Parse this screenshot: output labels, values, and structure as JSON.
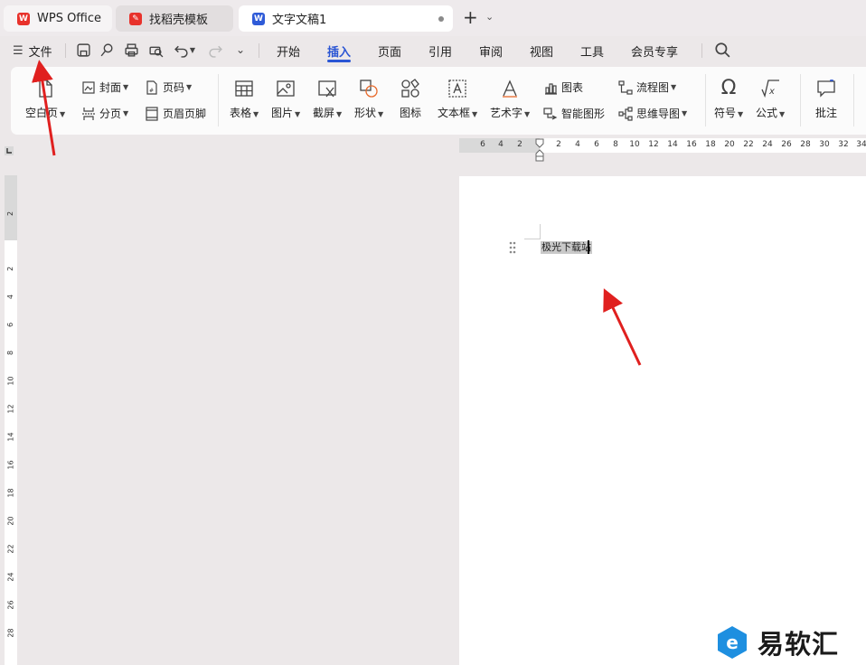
{
  "tabs": [
    {
      "label": "WPS Office",
      "color": "#e8322b",
      "icon": "wps-logo-icon"
    },
    {
      "label": "找稻壳模板",
      "color": "#e8322b",
      "icon": "docer-icon"
    },
    {
      "label": "文字文稿1",
      "color": "#2f5bd8",
      "icon": "word-doc-icon",
      "glyph": "W"
    }
  ],
  "new_tab": "+",
  "menu": {
    "file_label": "文件",
    "tabs": [
      "开始",
      "插入",
      "页面",
      "引用",
      "审阅",
      "视图",
      "工具",
      "会员专享"
    ],
    "active_tab": "插入",
    "accent": "#2a55d4"
  },
  "ribbon": {
    "blank_page": "空白页",
    "cover": "封面",
    "page_break": "分页",
    "page_number": "页码",
    "header_footer": "页眉页脚",
    "table": "表格",
    "picture": "图片",
    "screenshot": "截屏",
    "shape": "形状",
    "icon": "图标",
    "text_box": "文本框",
    "word_art": "艺术字",
    "chart": "图表",
    "smart_art": "智能图形",
    "flowchart": "流程图",
    "mind_map": "思维导图",
    "symbol": "符号",
    "formula": "公式",
    "comment": "批注"
  },
  "hruler_labels": [
    "6",
    "4",
    "2",
    "2",
    "4",
    "6",
    "8",
    "10",
    "12",
    "14",
    "16",
    "18",
    "20",
    "22",
    "24",
    "26",
    "28",
    "30",
    "32",
    "34"
  ],
  "vruler_labels": [
    "2",
    "2",
    "4",
    "6",
    "8",
    "10",
    "12",
    "14",
    "16",
    "18",
    "20",
    "22",
    "24",
    "26",
    "28"
  ],
  "document": {
    "text": "极光下载站"
  },
  "watermark": {
    "text": "易软汇",
    "color": "#1e8fe0"
  },
  "annotation_color": "#e0201f"
}
